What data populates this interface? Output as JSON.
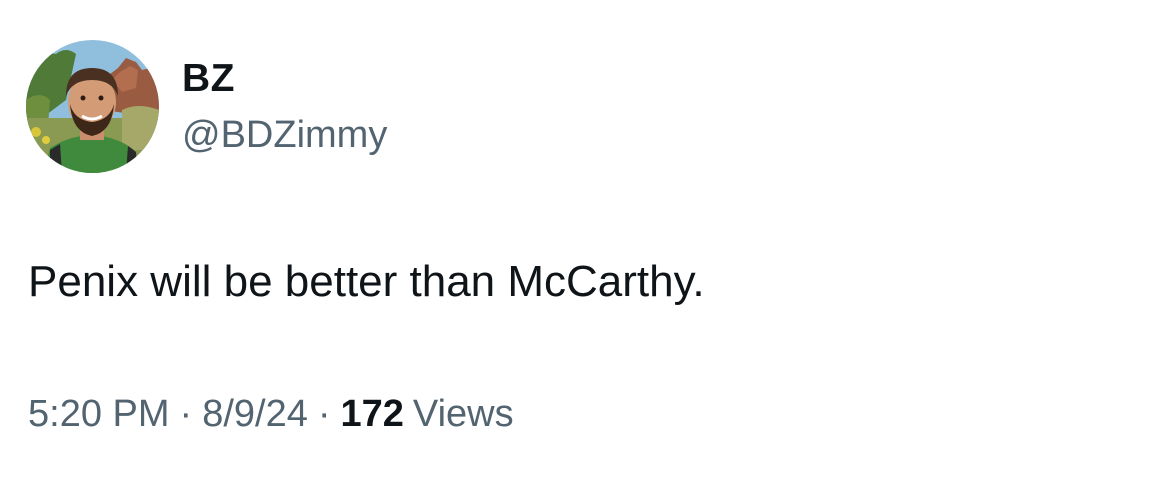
{
  "tweet": {
    "author": {
      "display_name": "BZ",
      "handle": "@BDZimmy",
      "avatar_icon": "profile-photo"
    },
    "text": "Penix will be better than McCarthy.",
    "meta": {
      "time": "5:20 PM",
      "date": "8/9/24",
      "separator": "·",
      "views_count": "172",
      "views_label": "Views"
    }
  },
  "colors": {
    "text_primary": "#0f1419",
    "text_secondary": "#536471",
    "background": "#ffffff"
  }
}
